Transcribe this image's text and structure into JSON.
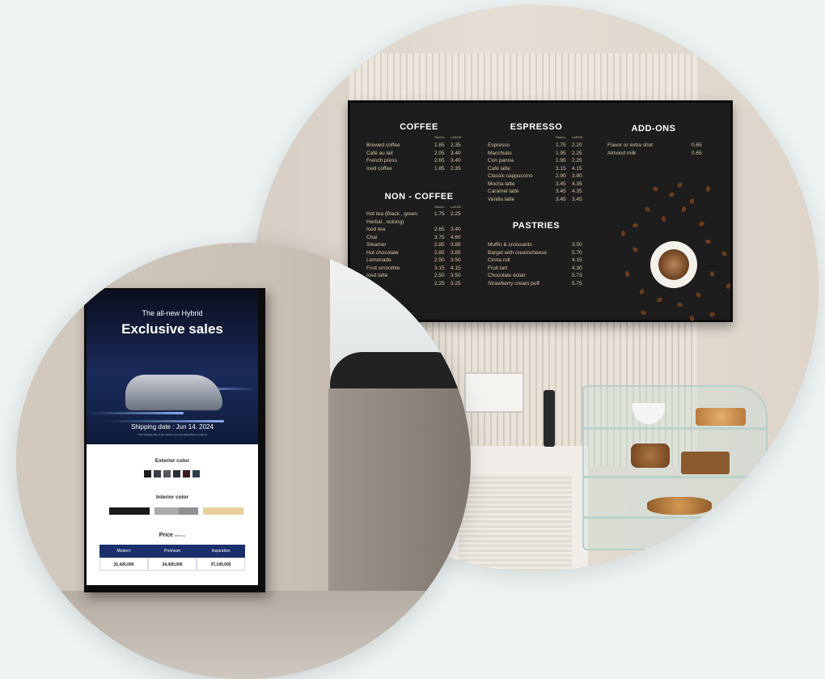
{
  "menu": {
    "coffee": {
      "title": "COFFEE",
      "small": "SMALL",
      "large": "LARGE",
      "items": [
        {
          "name": "Brewed coffee",
          "s": "1.85",
          "l": "2.35"
        },
        {
          "name": "Café au lait",
          "s": "2.05",
          "l": "3.40"
        },
        {
          "name": "French press",
          "s": "2.65",
          "l": "3.40"
        },
        {
          "name": "Iced coffee",
          "s": "1.85",
          "l": "2.35"
        }
      ]
    },
    "noncoffee": {
      "title": "NON - COFFEE",
      "small": "SMALL",
      "large": "LARGE",
      "items": [
        {
          "name": "Hot tea (Black , green",
          "s": "1.75",
          "l": "2.25"
        },
        {
          "name": "Herbal , oolong)",
          "s": "",
          "l": ""
        },
        {
          "name": "Iced tea",
          "s": "2.65",
          "l": "3.40"
        },
        {
          "name": "Chai",
          "s": "3.75",
          "l": "4.60"
        },
        {
          "name": "Steamer",
          "s": "2.85",
          "l": "3.85"
        },
        {
          "name": "Hot chocolate",
          "s": "2.85",
          "l": "3.85"
        },
        {
          "name": "Lemonade",
          "s": "2.50",
          "l": "3.50"
        },
        {
          "name": "Fruit smoothie",
          "s": "3.15",
          "l": "4.15"
        },
        {
          "name": "Iced latte",
          "s": "2.50",
          "l": "3.50"
        },
        {
          "name": "",
          "s": "2.25",
          "l": "3.25"
        }
      ]
    },
    "espresso": {
      "title": "ESPRESSO",
      "small": "SMALL",
      "large": "LARGE",
      "items": [
        {
          "name": "Espresso",
          "s": "1.75",
          "l": "2.20"
        },
        {
          "name": "Macchiato",
          "s": "1.95",
          "l": "2.25"
        },
        {
          "name": "Con panna",
          "s": "1.95",
          "l": "2.25"
        },
        {
          "name": "Café latte",
          "s": "3.15",
          "l": "4.15"
        },
        {
          "name": "Classic cappuccino",
          "s": "2.90",
          "l": "3.90"
        },
        {
          "name": "Mocha latte",
          "s": "3.45",
          "l": "4.35"
        },
        {
          "name": "Caramel latte",
          "s": "3.45",
          "l": "4.35"
        },
        {
          "name": "Vanilla latte",
          "s": "3.45",
          "l": "3.45"
        }
      ]
    },
    "pastries": {
      "title": "PASTRIES",
      "items": [
        {
          "name": "Muffin & croissants",
          "p": "3.50"
        },
        {
          "name": "Bargel with creamcheese",
          "p": "5.70"
        },
        {
          "name": "Cinna roll",
          "p": "4.15"
        },
        {
          "name": "Fruit tart",
          "p": "4.30"
        },
        {
          "name": "Chocolate éclair",
          "p": "5.73"
        },
        {
          "name": "Strawberry cream puff",
          "p": "5.75"
        }
      ]
    },
    "addons": {
      "title": "ADD-ONS",
      "items": [
        {
          "name": "Flavor or extra shot",
          "p": "0.65"
        },
        {
          "name": "Almond milk",
          "p": "0.65"
        }
      ]
    }
  },
  "kiosk": {
    "subtitle": "The all-new Hybrid",
    "title": "Exclusive sales",
    "shipping": "Shipping date : Jun 14. 2024",
    "disclaimer": "* The shipping date of the vehicle may vary depending on options.",
    "exterior_label": "Exterior color",
    "exterior_colors": [
      "#1c1c1c",
      "#3a3d44",
      "#55585e",
      "#2a2f3a",
      "#3b1820",
      "#2e3c4c"
    ],
    "interior_label": "Interior color",
    "interior_colors": [
      "#1a1a1a",
      "#a9aaad",
      "#8f9093",
      "#e8cf9c"
    ],
    "price_label": "Price",
    "price_note": "(VAT incl.)",
    "price_headers": [
      "Modern",
      "Premium",
      "Inspiration"
    ],
    "price_values": [
      "31,420,000",
      "34,420,000",
      "37,190,000"
    ]
  }
}
